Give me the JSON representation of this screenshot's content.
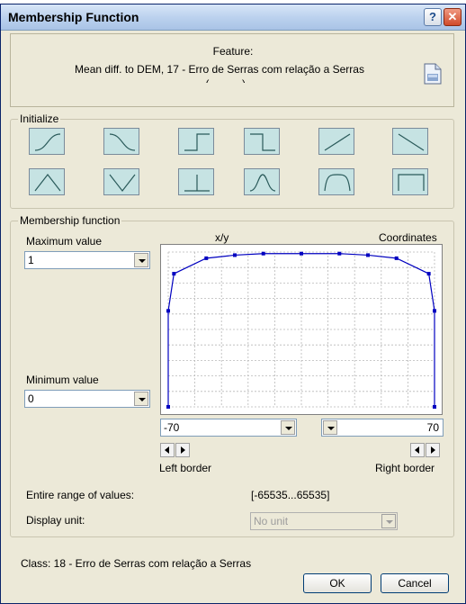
{
  "window": {
    "title": "Membership Function",
    "help_glyph": "?",
    "close_glyph": "✕"
  },
  "feature": {
    "label": "Feature:",
    "name": "Mean diff. to DEM, 17 - Erro de Serras com relação a Serras",
    "name_line2": "... (... ... ...)",
    "icon": "document-properties-icon"
  },
  "initialize": {
    "label": "Initialize",
    "buttons": [
      {
        "name": "larger-s-shape-icon"
      },
      {
        "name": "smaller-s-shape-icon"
      },
      {
        "name": "larger-step-icon"
      },
      {
        "name": "smaller-step-icon"
      },
      {
        "name": "linear-increasing-icon"
      },
      {
        "name": "linear-decreasing-icon"
      },
      {
        "name": "triangle-icon"
      },
      {
        "name": "inverted-triangle-icon"
      },
      {
        "name": "singleton-icon"
      },
      {
        "name": "approximate-gaussian-icon"
      },
      {
        "name": "about-range-icon"
      },
      {
        "name": "full-range-icon"
      }
    ]
  },
  "membership": {
    "label": "Membership function",
    "max_label": "Maximum value",
    "max_value": "1",
    "min_label": "Minimum value",
    "min_value": "0",
    "xy_label": "x/y",
    "coordinates_label": "Coordinates",
    "left_border_value": "-70",
    "right_border_value": "70",
    "left_border_label": "Left border",
    "right_border_label": "Right border",
    "range_label": "Entire range of values:",
    "range_value": "[-65535...65535]",
    "unit_label": "Display unit:",
    "unit_value": "No unit",
    "line_color": "#0000c0"
  },
  "chart_data": {
    "type": "line",
    "x": [
      -70,
      -70,
      -67,
      -50,
      -35,
      -20,
      0,
      20,
      35,
      50,
      67,
      70,
      70
    ],
    "y": [
      0,
      0.62,
      0.86,
      0.96,
      0.98,
      0.99,
      0.99,
      0.99,
      0.98,
      0.96,
      0.86,
      0.62,
      0
    ],
    "xlim": [
      -70,
      70
    ],
    "ylim": [
      0,
      1
    ],
    "grid": true
  },
  "class_text": "Class: 18 - Erro de Serras com relação a Serras",
  "buttons": {
    "ok": "OK",
    "cancel": "Cancel"
  }
}
